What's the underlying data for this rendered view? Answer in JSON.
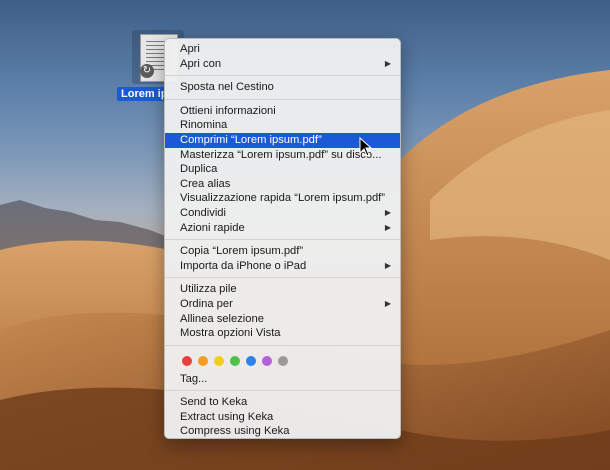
{
  "file": {
    "label": "Lorem ipsum.pdf"
  },
  "menu": {
    "sections": [
      [
        {
          "label": "Apri"
        },
        {
          "label": "Apri con",
          "submenu": true
        }
      ],
      [
        {
          "label": "Sposta nel Cestino"
        }
      ],
      [
        {
          "label": "Ottieni informazioni"
        },
        {
          "label": "Rinomina"
        },
        {
          "label": "Comprimi “Lorem ipsum.pdf”",
          "highlighted": true
        },
        {
          "label": "Masterizza “Lorem ipsum.pdf” su disco..."
        },
        {
          "label": "Duplica"
        },
        {
          "label": "Crea alias"
        },
        {
          "label": "Visualizzazione rapida “Lorem ipsum.pdf”"
        },
        {
          "label": "Condividi",
          "submenu": true
        },
        {
          "label": "Azioni rapide",
          "submenu": true
        }
      ],
      [
        {
          "label": "Copia “Lorem ipsum.pdf”"
        },
        {
          "label": "Importa da iPhone o iPad",
          "submenu": true
        }
      ],
      [
        {
          "label": "Utilizza pile"
        },
        {
          "label": "Ordina per",
          "submenu": true
        },
        {
          "label": "Allinea selezione"
        },
        {
          "label": "Mostra opzioni Vista"
        }
      ],
      [
        {
          "type": "tags"
        },
        {
          "label": "Tag..."
        }
      ],
      [
        {
          "label": "Send to Keka"
        },
        {
          "label": "Extract using Keka"
        },
        {
          "label": "Compress using Keka"
        }
      ]
    ],
    "tag_colors": [
      {
        "name": "red",
        "color": "#e8413c"
      },
      {
        "name": "orange",
        "color": "#f39c22"
      },
      {
        "name": "yellow",
        "color": "#f2cc1f"
      },
      {
        "name": "green",
        "color": "#4ec04a"
      },
      {
        "name": "blue",
        "color": "#2f80e8"
      },
      {
        "name": "purple",
        "color": "#b460d8"
      },
      {
        "name": "gray",
        "color": "#9a9a9a"
      }
    ],
    "submenu_icon": "chevron-right-icon",
    "highlight_color": "#1b59d6"
  }
}
